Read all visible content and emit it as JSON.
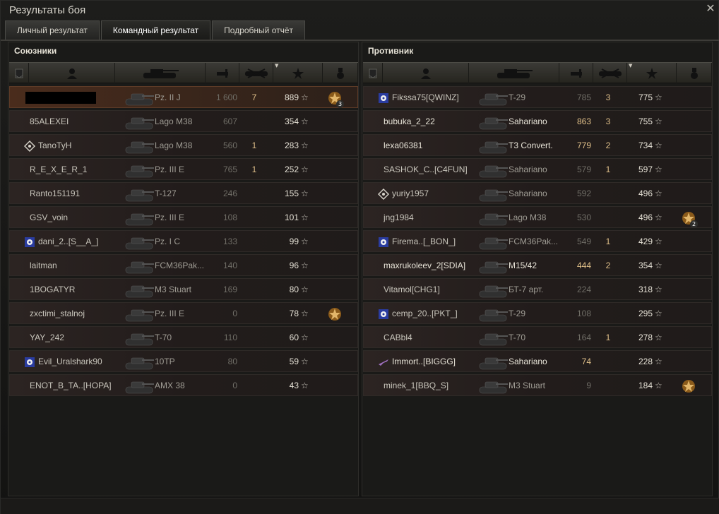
{
  "window": {
    "title": "Результаты боя"
  },
  "tabs": [
    {
      "label": "Личный результат"
    },
    {
      "label": "Командный результат",
      "active": true
    },
    {
      "label": "Подробный отчёт"
    }
  ],
  "allies": {
    "title": "Союзники",
    "rows": [
      {
        "player": "",
        "redacted": true,
        "vehicle": "Pz. II J",
        "damage": "1 600",
        "kills": "7",
        "xp": "889",
        "medal": "3",
        "me": true
      },
      {
        "player": "85ALEXEI",
        "vehicle": "Lago M38",
        "damage": "607",
        "kills": "",
        "xp": "354"
      },
      {
        "player": "TanoTyH",
        "icon": "diamond",
        "vehicle": "Lago M38",
        "damage": "560",
        "kills": "1",
        "xp": "283"
      },
      {
        "player": "R_E_X_E_R_1",
        "vehicle": "Pz. III E",
        "damage": "765",
        "kills": "1",
        "xp": "252"
      },
      {
        "player": "Ranto151191",
        "vehicle": "T-127",
        "damage": "246",
        "kills": "",
        "xp": "155"
      },
      {
        "player": "GSV_voin",
        "vehicle": "Pz. III E",
        "damage": "108",
        "kills": "",
        "xp": "101"
      },
      {
        "player": "dani_2..[S__A_]",
        "icon": "clan",
        "vehicle": "Pz. I C",
        "damage": "133",
        "kills": "",
        "xp": "99"
      },
      {
        "player": "laitman",
        "vehicle": "FCM36Pak...",
        "damage": "140",
        "kills": "",
        "xp": "96"
      },
      {
        "player": "1BOGATYR",
        "vehicle": "M3 Stuart",
        "damage": "169",
        "kills": "",
        "xp": "80"
      },
      {
        "player": "zxctimi_stalnoj",
        "vehicle": "Pz. III E",
        "damage": "0",
        "kills": "",
        "xp": "78",
        "medal": ""
      },
      {
        "player": "YAY_242",
        "vehicle": "T-70",
        "damage": "110",
        "kills": "",
        "xp": "60"
      },
      {
        "player": "Evil_Uralshark90",
        "icon": "clan",
        "vehicle": "10TP",
        "damage": "80",
        "kills": "",
        "xp": "59"
      },
      {
        "player": "ENOT_B_TA..[HOPA]",
        "vehicle": "AMX 38",
        "damage": "0",
        "kills": "",
        "xp": "43"
      }
    ]
  },
  "enemies": {
    "title": "Противник",
    "rows": [
      {
        "player": "Fikssa75[QWINZ]",
        "icon": "clan",
        "vehicle": "T-29",
        "damage": "785",
        "kills": "3",
        "xp": "775"
      },
      {
        "player": "bubuka_2_22",
        "vehicle": "Sahariano",
        "damage": "863",
        "damage_hi": true,
        "kills": "3",
        "xp": "755",
        "bright": true
      },
      {
        "player": "lexa06381",
        "vehicle": "T3 Convert.",
        "damage": "779",
        "damage_hi": true,
        "kills": "2",
        "xp": "734",
        "bright": true
      },
      {
        "player": "SASHOK_C..[C4FUN]",
        "vehicle": "Sahariano",
        "damage": "579",
        "kills": "1",
        "xp": "597"
      },
      {
        "player": "yuriy1957",
        "icon": "diamond",
        "vehicle": "Sahariano",
        "damage": "592",
        "kills": "",
        "xp": "496"
      },
      {
        "player": "jng1984",
        "vehicle": "Lago M38",
        "damage": "530",
        "kills": "",
        "xp": "496",
        "medal": "2"
      },
      {
        "player": "Firema..[_BON_]",
        "icon": "clan",
        "vehicle": "FCM36Pak...",
        "damage": "549",
        "kills": "1",
        "xp": "429"
      },
      {
        "player": "maxrukoleev_2[SDIA]",
        "vehicle": "M15/42",
        "damage": "444",
        "damage_hi": true,
        "kills": "2",
        "xp": "354",
        "bright": true
      },
      {
        "player": "Vitamol[CHG1]",
        "vehicle": "БТ-7 арт.",
        "damage": "224",
        "kills": "",
        "xp": "318"
      },
      {
        "player": "cemp_20..[PKT_]",
        "icon": "clan",
        "vehicle": "T-29",
        "damage": "108",
        "kills": "",
        "xp": "295"
      },
      {
        "player": "CABbl4",
        "vehicle": "T-70",
        "damage": "164",
        "kills": "1",
        "xp": "278"
      },
      {
        "player": "Immort..[BIGGG]",
        "icon": "plane",
        "vehicle": "Sahariano",
        "damage": "74",
        "damage_hi": true,
        "kills": "",
        "xp": "228",
        "bright": true
      },
      {
        "player": "minek_1[BBQ_S]",
        "vehicle": "M3 Stuart",
        "damage": "9",
        "kills": "",
        "xp": "184",
        "medal": ""
      }
    ]
  },
  "star_glyph": "☆",
  "close_glyph": "✕",
  "colors": {
    "accent": "#e0c08a",
    "my_row": "#4a2c1c",
    "row": "#2c2422"
  }
}
